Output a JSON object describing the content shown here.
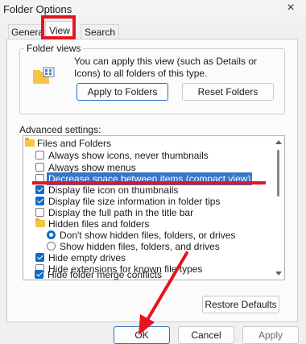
{
  "window": {
    "title": "Folder Options",
    "close_glyph": "×"
  },
  "tabs": [
    {
      "label": "General",
      "visible_text": "Genera"
    },
    {
      "label": "View"
    },
    {
      "label": "Search"
    }
  ],
  "folder_views": {
    "title": "Folder views",
    "description": "You can apply this view (such as Details or Icons) to all folders of this type.",
    "apply_button": "Apply to Folders",
    "reset_button": "Reset Folders"
  },
  "advanced": {
    "label": "Advanced settings:",
    "items": [
      {
        "type": "folder",
        "label": "Files and Folders"
      },
      {
        "type": "checkbox",
        "label": "Always show icons, never thumbnails",
        "checked": false
      },
      {
        "type": "checkbox",
        "label": "Always show menus",
        "checked": false
      },
      {
        "type": "checkbox",
        "label": "Decrease space between items (compact view)",
        "checked": false,
        "selected": true
      },
      {
        "type": "checkbox",
        "label": "Display file icon on thumbnails",
        "checked": true
      },
      {
        "type": "checkbox",
        "label": "Display file size information in folder tips",
        "checked": true
      },
      {
        "type": "checkbox",
        "label": "Display the full path in the title bar",
        "checked": false
      },
      {
        "type": "folder",
        "label": "Hidden files and folders"
      },
      {
        "type": "radio",
        "label": "Don't show hidden files, folders, or drives",
        "checked": true
      },
      {
        "type": "radio",
        "label": "Show hidden files, folders, and drives",
        "checked": false
      },
      {
        "type": "checkbox",
        "label": "Hide empty drives",
        "checked": true
      },
      {
        "type": "checkbox",
        "label": "Hide extensions for known file types",
        "checked": false
      },
      {
        "type": "checkbox",
        "label": "Hide folder merge conflicts",
        "checked": true
      }
    ],
    "restore_button": "Restore Defaults"
  },
  "footer": {
    "ok": "OK",
    "cancel": "Cancel",
    "apply": "Apply"
  },
  "colors": {
    "accent": "#0f6cc4",
    "selection": "#3a73c8",
    "annotation": "#e4151f"
  }
}
